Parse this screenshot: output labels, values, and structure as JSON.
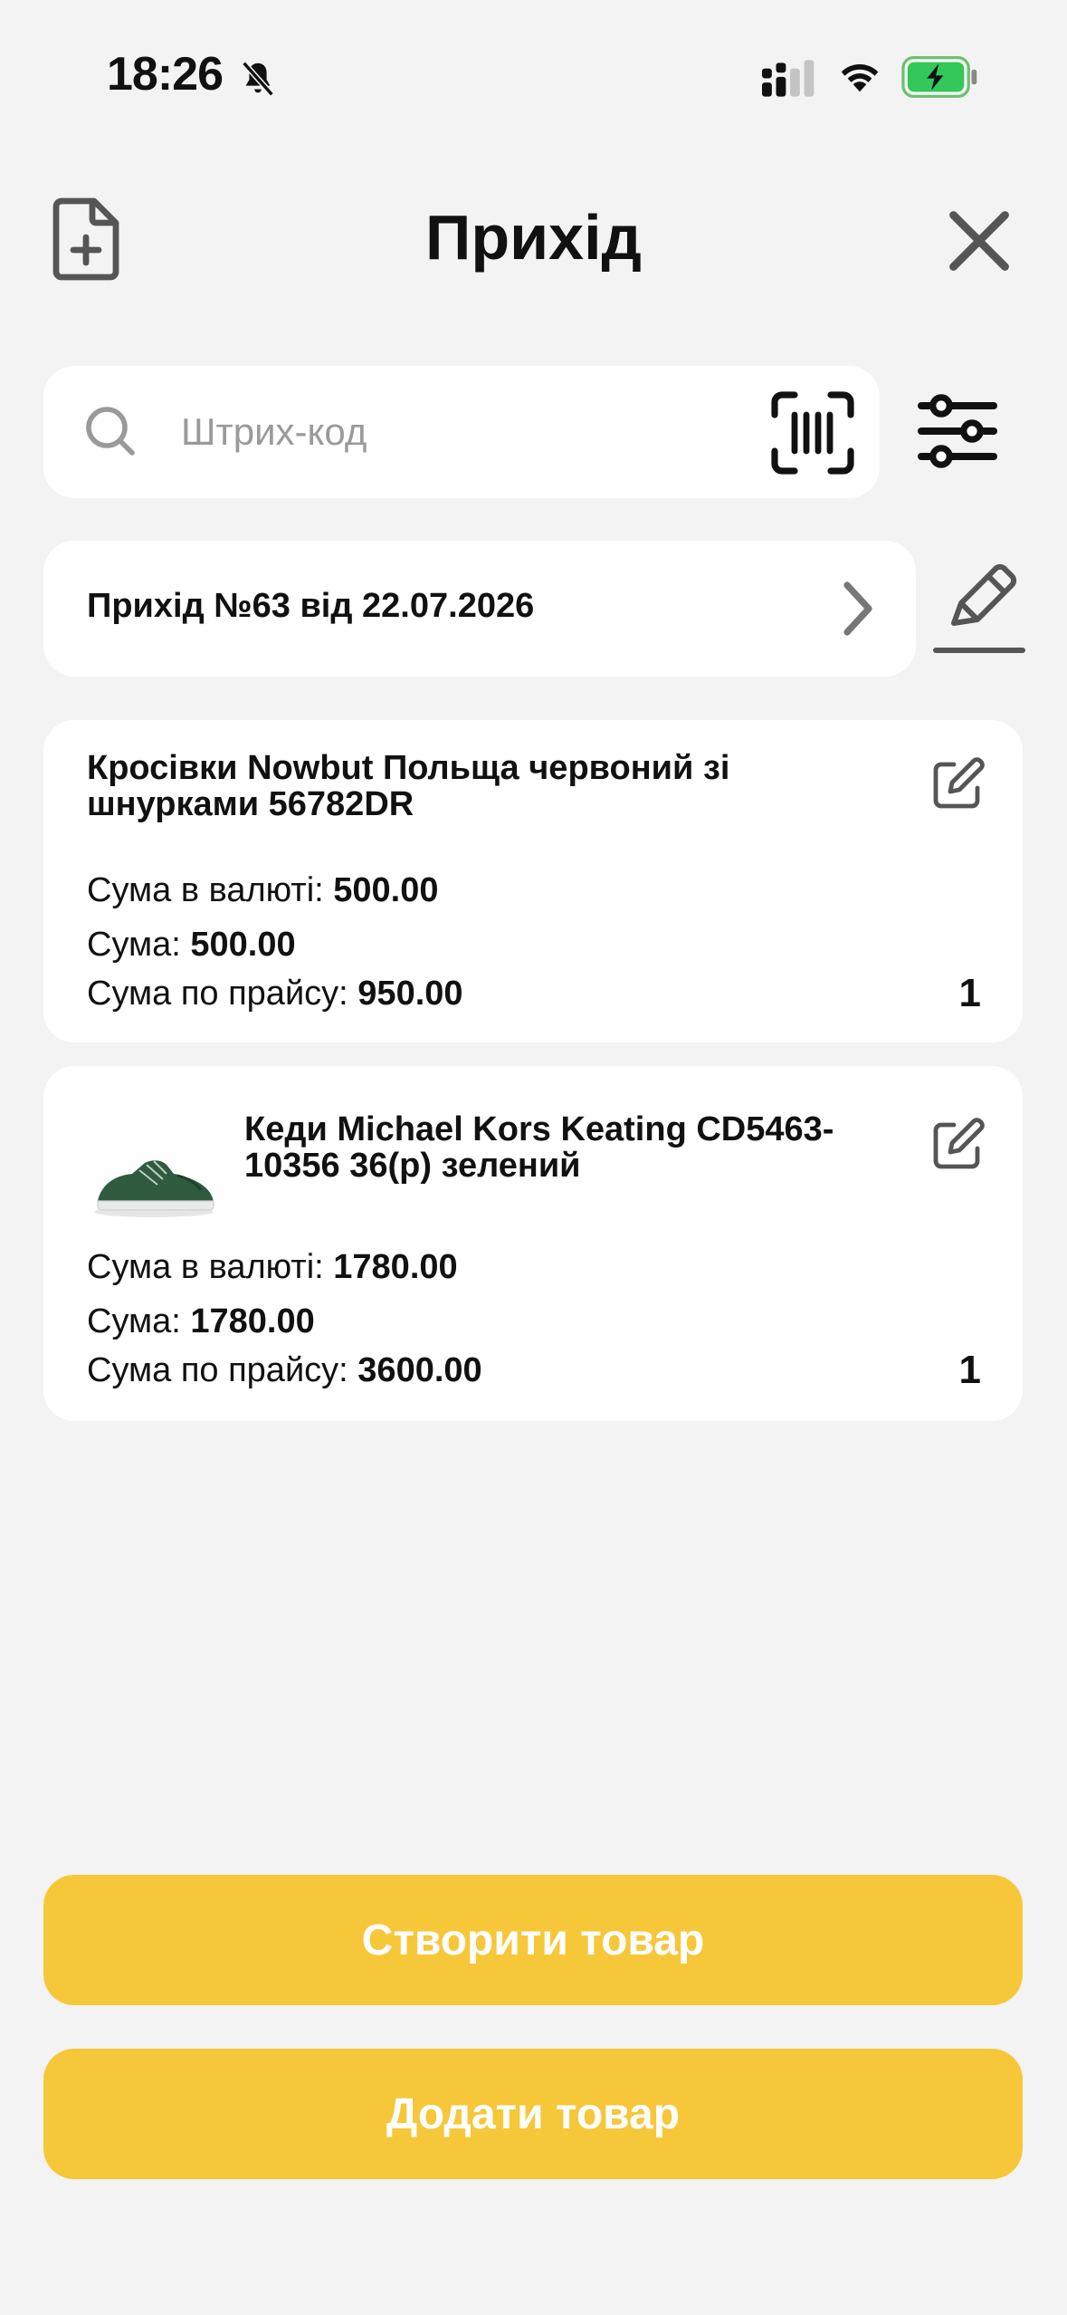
{
  "status_bar": {
    "time": "18:26"
  },
  "header": {
    "title": "Прихід"
  },
  "search": {
    "placeholder": "Штрих-код",
    "value": ""
  },
  "document": {
    "label": "Прихід №63 від 22.07.2026"
  },
  "items": [
    {
      "name": "Кросівки Nowbut Польща червоний зі шнурками 56782DR",
      "currency_sum_label": "Сума в валюті: ",
      "currency_sum": "500.00",
      "sum_label": "Сума: ",
      "sum": "500.00",
      "price_sum_label": "Сума по прайсу: ",
      "price_sum": "950.00",
      "qty": "1"
    },
    {
      "name": "Кеди Michael Kors Keating CD5463-10356 36(р) зелений",
      "currency_sum_label": "Сума в валюті: ",
      "currency_sum": "1780.00",
      "sum_label": "Сума: ",
      "sum": "1780.00",
      "price_sum_label": "Сума по прайсу: ",
      "price_sum": "3600.00",
      "qty": "1"
    }
  ],
  "actions": {
    "create_label": "Створити товар",
    "add_label": "Додати товар"
  },
  "colors": {
    "accent": "#f7c73a",
    "background": "#f3f3f3",
    "battery_charging": "#34c759"
  },
  "icons": [
    "bell-slash-icon",
    "signal-icon",
    "wifi-icon",
    "battery-icon",
    "document-add-icon",
    "close-icon",
    "search-icon",
    "barcode-scan-icon",
    "filter-sliders-icon",
    "chevron-right-icon",
    "edit-pen-icon",
    "edit-square-icon"
  ]
}
